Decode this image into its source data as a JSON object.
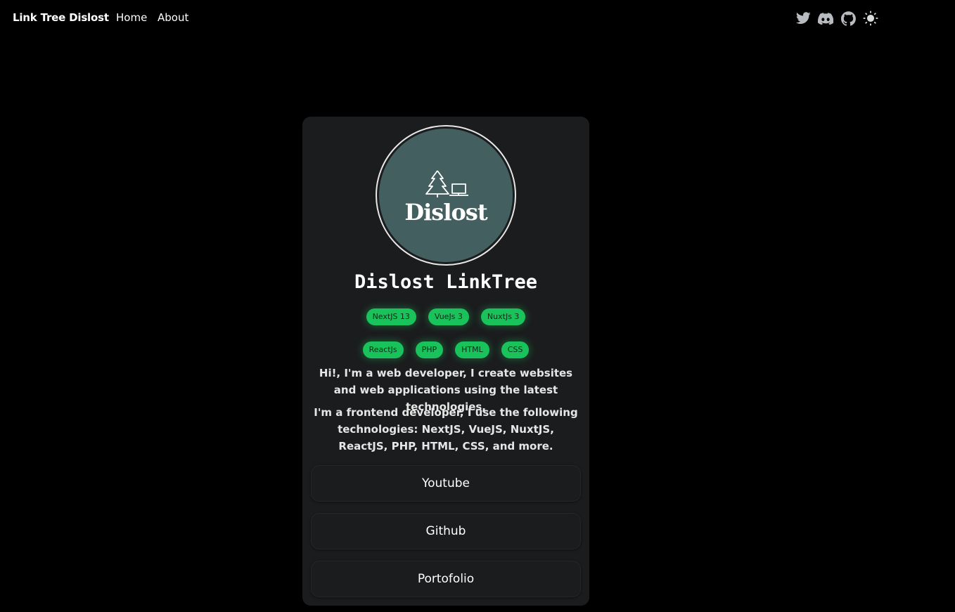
{
  "nav": {
    "brand": "Link Tree Dislost",
    "links": [
      {
        "label": "Home"
      },
      {
        "label": "About"
      }
    ],
    "icons": [
      "twitter-icon",
      "discord-icon",
      "github-icon",
      "sun-icon"
    ],
    "icon_color": "#b8bcc0"
  },
  "profile": {
    "logo_text": "Dislost",
    "title": "Dislost LinkTree",
    "tags_row1": [
      "NextJS 13",
      "VueJs 3",
      "NuxtJs 3"
    ],
    "tags_row2": [
      "ReactJs",
      "PHP",
      "HTML",
      "CSS"
    ],
    "bio": [
      "Hi!, I'm a web developer, I create websites and web applications using the latest technologies,",
      "I'm a frontend developer, I use the following technologies: NextJS, VueJS, NuxtJS, ReactJS, PHP, HTML, CSS, and more."
    ]
  },
  "links": [
    {
      "label": "Youtube"
    },
    {
      "label": "Github"
    },
    {
      "label": "Portofolio"
    }
  ],
  "colors": {
    "background": "#000000",
    "card": "#1b1c1e",
    "avatar": "#435f60",
    "tag": "#19c25a"
  }
}
